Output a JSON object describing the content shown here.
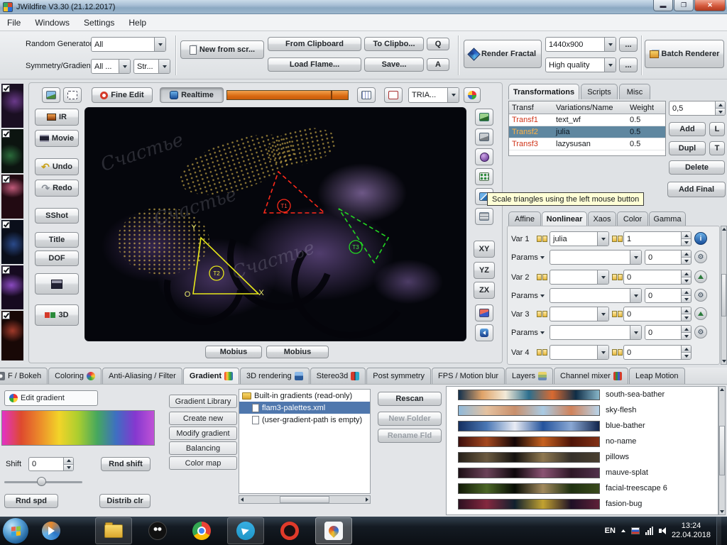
{
  "window": {
    "title": "JWildfire V3.30 (21.12.2017)",
    "menu": [
      "File",
      "Windows",
      "Settings",
      "Help"
    ]
  },
  "toolbar": {
    "random_generator_label": "Random Generator",
    "random_generator_value": "All",
    "symmetry_label": "Symmetry/Gradient",
    "symmetry_value": "All ...",
    "style_value": "Str...",
    "new_from_scratch": "New from scr...",
    "from_clipboard": "From Clipboard",
    "to_clipboard": "To Clipbo...",
    "q": "Q",
    "load_flame": "Load Flame...",
    "save": "Save...",
    "a": "A",
    "render_fractal": "Render Fractal",
    "resolution": "1440x900",
    "quality": "High quality",
    "more": "...",
    "batch_renderer": "Batch Renderer"
  },
  "editor": {
    "fine_edit": "Fine Edit",
    "realtime": "Realtime",
    "triangle_style": "TRIA...",
    "buttons": {
      "ir": "IR",
      "movie": "Movie",
      "undo": "Undo",
      "redo": "Redo",
      "sshot": "SShot",
      "title": "Title",
      "dof": "DOF",
      "threed": "3D"
    },
    "views": [
      "XY",
      "YZ",
      "ZX"
    ],
    "mobius_left": "Mobius",
    "mobius_right": "Mobius",
    "tooltip": "Scale triangles using the left mouse button",
    "axes": {
      "x": "X",
      "y": "Y",
      "o": "O"
    },
    "triangles": [
      "T1",
      "T2",
      "T3"
    ],
    "watermark": "Счастье"
  },
  "transforms": {
    "tabs": [
      "Transformations",
      "Scripts",
      "Misc"
    ],
    "headers": [
      "Transf",
      "Variations/Name",
      "Weight"
    ],
    "rows": [
      {
        "name": "Transf1",
        "variation": "text_wf",
        "weight": "0.5"
      },
      {
        "name": "Transf2",
        "variation": "julia",
        "weight": "0.5"
      },
      {
        "name": "Transf3",
        "variation": "lazysusan",
        "weight": "0.5"
      }
    ],
    "selected_index": 1,
    "weight_value": "0,5",
    "buttons": {
      "add": "Add",
      "l": "L",
      "dupl": "Dupl",
      "t": "T",
      "delete": "Delete",
      "add_final": "Add Final"
    },
    "subtabs": [
      "Affine",
      "Nonlinear",
      "Xaos",
      "Color",
      "Gamma"
    ],
    "nonlinear": {
      "var1_label": "Var 1",
      "var1_value": "julia",
      "var1_amount": "1",
      "params_label": "Params",
      "params1_amount": "0",
      "var2_label": "Var 2",
      "var2_amount": "0",
      "params2_amount": "0",
      "var3_label": "Var 3",
      "var3_amount": "0",
      "params3_amount": "0",
      "var4_label": "Var 4",
      "var4_amount": "0"
    }
  },
  "bottom_tabs": [
    "F / Bokeh",
    "Coloring",
    "Anti-Aliasing / Filter",
    "Gradient",
    "3D rendering",
    "Stereo3d",
    "Post symmetry",
    "FPS / Motion blur",
    "Layers",
    "Channel mixer",
    "Leap Motion"
  ],
  "gradient_panel": {
    "edit_gradient": "Edit gradient",
    "shift_label": "Shift",
    "shift_value": "0",
    "rnd_shift": "Rnd shift",
    "rnd_spd": "Rnd spd",
    "distrib_clr": "Distrib clr",
    "library_buttons": [
      "Gradient Library",
      "Create new",
      "Modify gradient",
      "Balancing",
      "Color map"
    ],
    "tree": {
      "root": "Built-in gradients (read-only)",
      "selected_file": "flam3-palettes.xml",
      "empty_path": "(user-gradient-path is empty)"
    },
    "file_buttons": {
      "rescan": "Rescan",
      "new_folder": "New Folder",
      "rename_fld": "Rename Fld"
    },
    "preview_colors": [
      "#e332c8",
      "#de4a2e",
      "#ec8c2a",
      "#f2d429",
      "#abce2f",
      "#46a85e",
      "#3e6fc2",
      "#8438cf",
      "#c052d6"
    ],
    "gradients": [
      {
        "name": "south-sea-bather",
        "colors": [
          "#13314e",
          "#e0a368",
          "#f2ead8",
          "#2c6f8e",
          "#d96a31",
          "#0f2d46",
          "#87b6c9"
        ]
      },
      {
        "name": "sky-flesh",
        "colors": [
          "#8fb9da",
          "#e5c2a0",
          "#c98f6b",
          "#a9cbe4",
          "#d0825a",
          "#b8d4ea"
        ]
      },
      {
        "name": "blue-bather",
        "colors": [
          "#142f60",
          "#4a77b5",
          "#e9ecf4",
          "#24539c",
          "#8aa8d4",
          "#10244c"
        ]
      },
      {
        "name": "no-name",
        "colors": [
          "#3d0f0c",
          "#a4481f",
          "#140606",
          "#c6611f",
          "#4e1508",
          "#823015"
        ]
      },
      {
        "name": "pillows",
        "colors": [
          "#262019",
          "#6b5a40",
          "#151210",
          "#8f7850",
          "#35302a",
          "#4a4030"
        ]
      },
      {
        "name": "mauve-splat",
        "colors": [
          "#1d0f16",
          "#6b4258",
          "#0e070c",
          "#8a5272",
          "#2e1826",
          "#51304a"
        ]
      },
      {
        "name": "facial-treescape 6",
        "colors": [
          "#121a07",
          "#4b6626",
          "#070c04",
          "#a28a5e",
          "#1f3110",
          "#3a4a1c"
        ]
      },
      {
        "name": "fasion-bug",
        "colors": [
          "#2e1020",
          "#84283f",
          "#10202e",
          "#c2a231",
          "#1e1026",
          "#5e2038"
        ]
      }
    ]
  },
  "glyphs": {
    "undo": "↶",
    "redo": "↷",
    "gear": "⚙",
    "info": "i"
  },
  "taskbar": {
    "language": "EN",
    "time": "13:24",
    "date": "22.04.2018"
  }
}
